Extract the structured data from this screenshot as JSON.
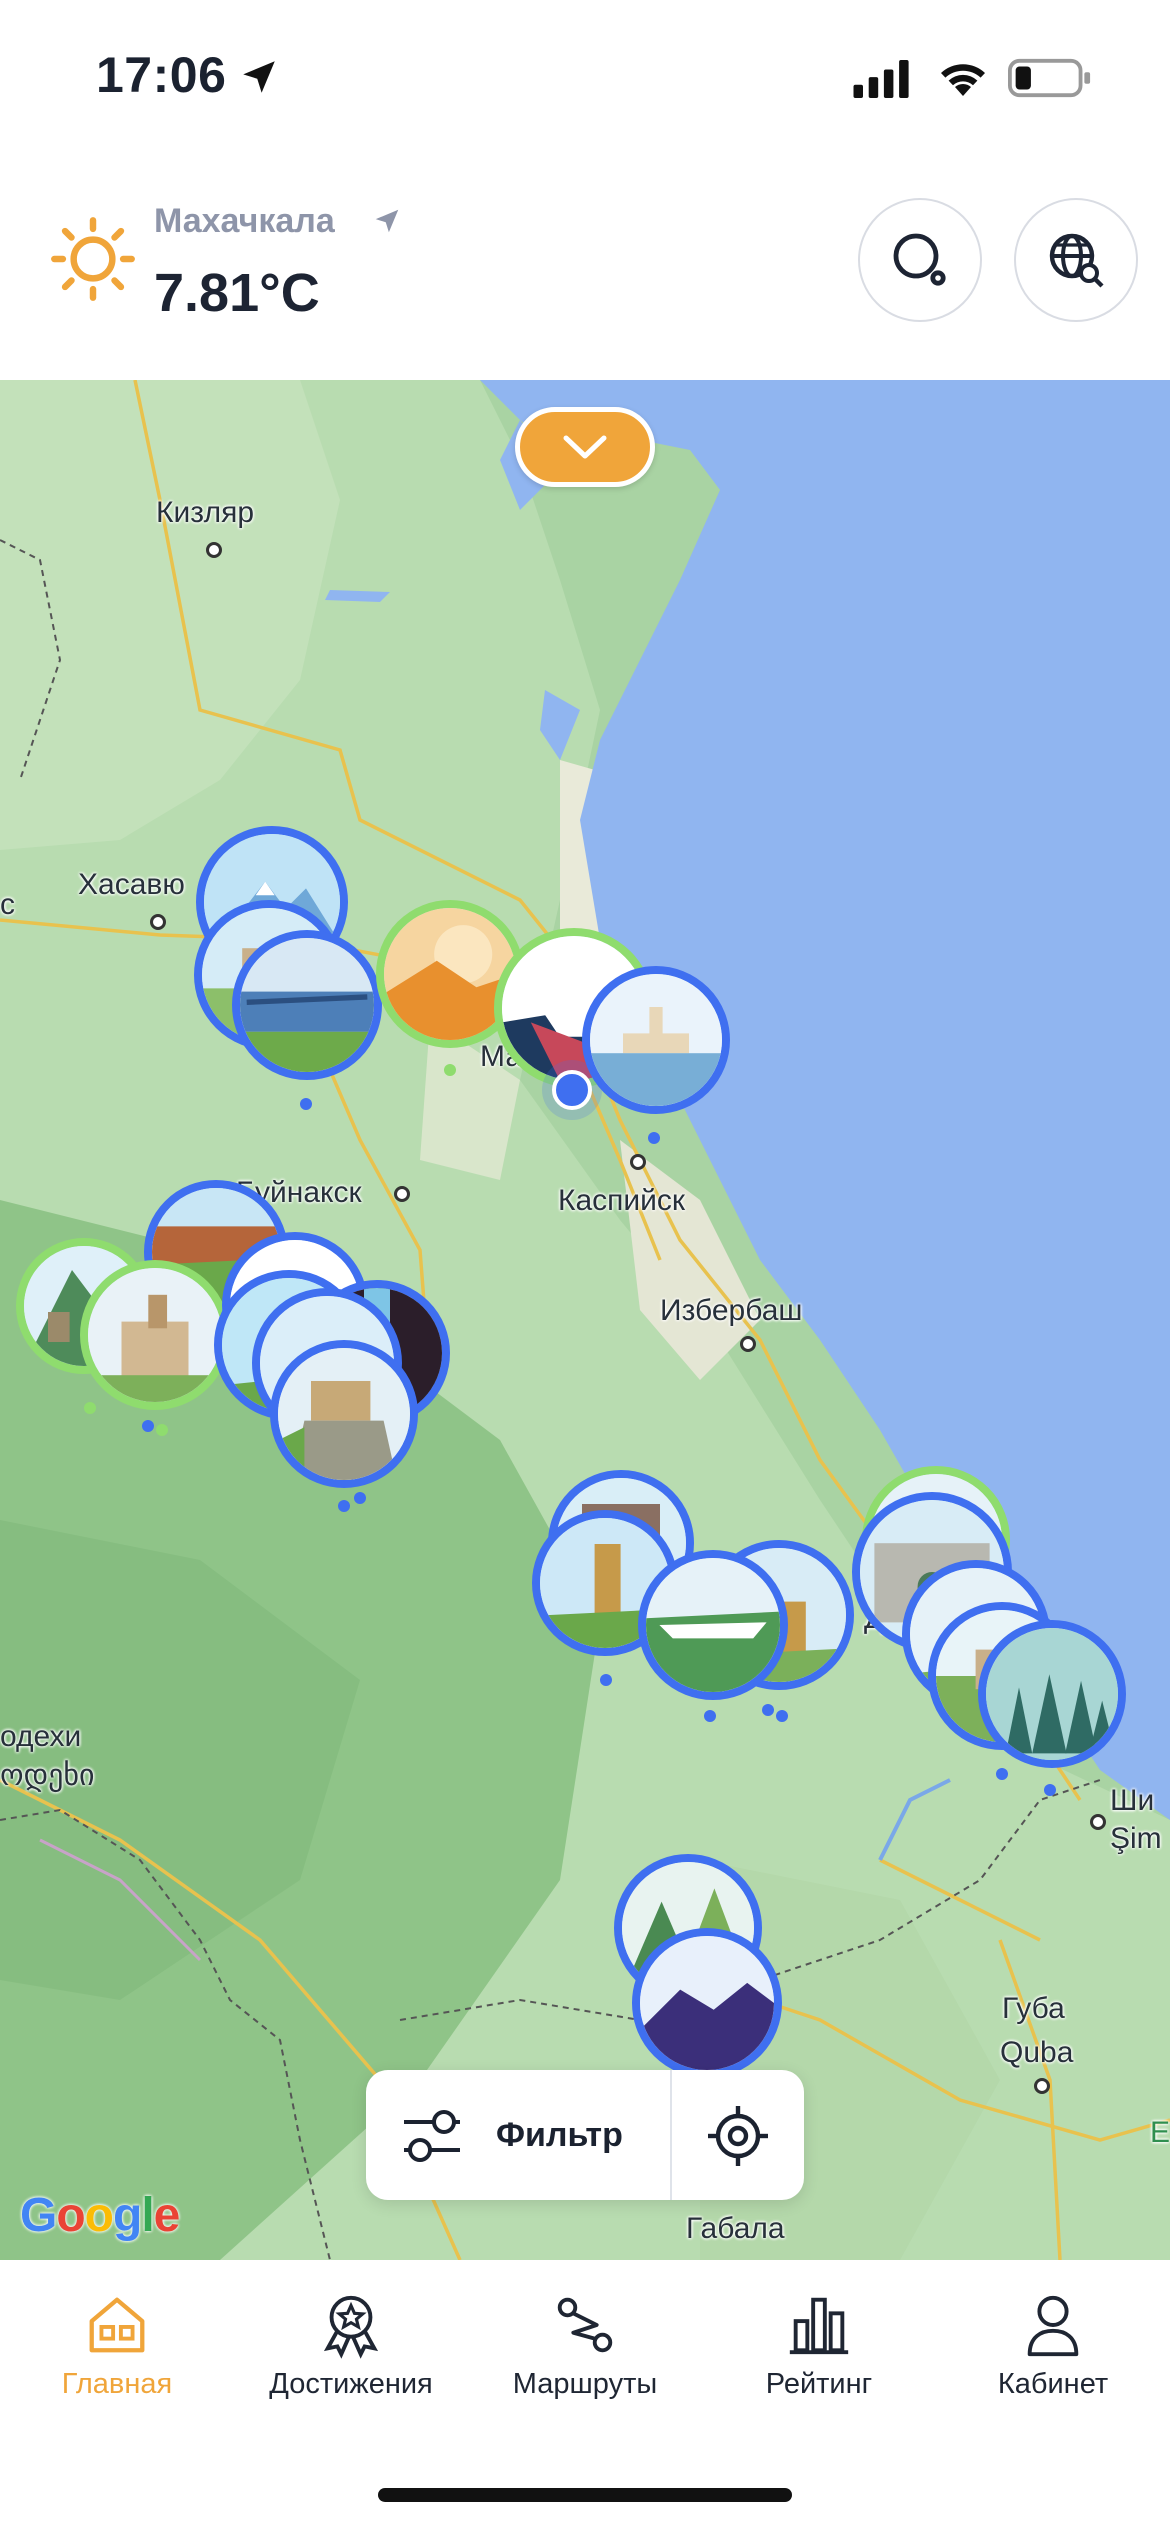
{
  "status_bar": {
    "time": "17:06",
    "icons": [
      "location-arrow-icon",
      "cellular-signal-icon",
      "wifi-icon",
      "battery-icon"
    ]
  },
  "weather": {
    "city": "Махачкала",
    "temperature": "7.81°C",
    "icon": "sun-icon"
  },
  "header_buttons": {
    "search_icon": "search-icon",
    "globe_icon": "globe-search-icon"
  },
  "map": {
    "labels": {
      "kizlyar": "Кизляр",
      "khasavyurt": "Хасавю",
      "khasavyurt_edge": "с",
      "makhachkala": "Ма",
      "buynaksk": "Буйнакск",
      "kaspiysk": "Каспийск",
      "izberbash": "Избербаш",
      "derbent": "Д",
      "lagodekhi": "одехи",
      "lagodekhi_ka": "ოდეხი",
      "shi": "Ши",
      "shim": "Şim",
      "guba": "Губа",
      "quba": "Quba",
      "gabala": "Габала",
      "edge_e": "E"
    },
    "google_logo": "Google",
    "colors": {
      "sea": "#90b5f0",
      "land": "#a9d3a3",
      "pin_blue": "#3f6ff0",
      "pin_green": "#8fdc6e"
    }
  },
  "controls": {
    "collapse_icon": "chevron-down-icon",
    "filter_label": "Фильтр",
    "filter_icon": "sliders-icon",
    "locate_icon": "crosshair-icon"
  },
  "tabs": [
    {
      "label": "Главная",
      "icon": "home-icon",
      "active": true
    },
    {
      "label": "Достижения",
      "icon": "award-icon",
      "active": false
    },
    {
      "label": "Маршруты",
      "icon": "route-icon",
      "active": false
    },
    {
      "label": "Рейтинг",
      "icon": "bar-chart-icon",
      "active": false
    },
    {
      "label": "Кабинет",
      "icon": "user-icon",
      "active": false
    }
  ],
  "accent_color": "#f0a53a"
}
